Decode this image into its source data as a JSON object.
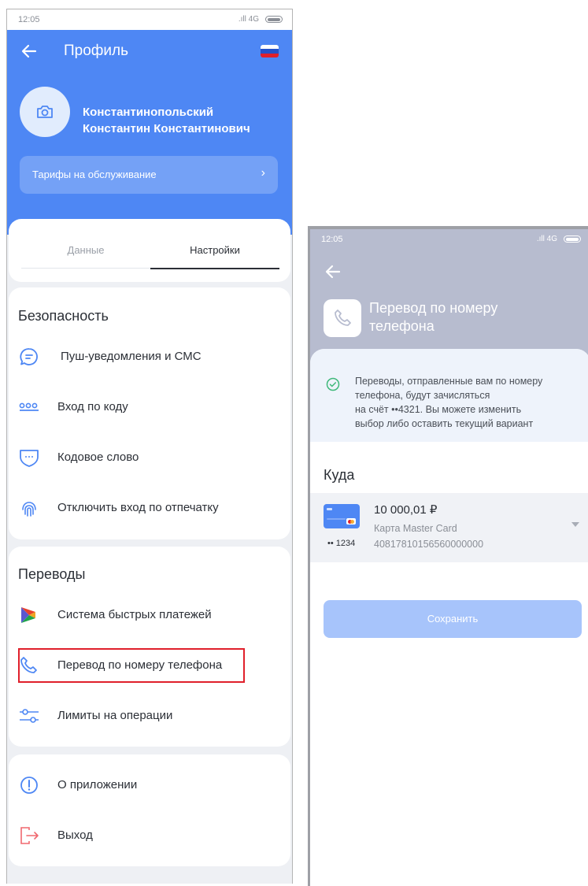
{
  "left_screen": {
    "status": {
      "time": "12:05",
      "network": ".ıll 4G"
    },
    "header": {
      "title": "Профиль"
    },
    "profile": {
      "name_line1": "Константинопольский",
      "name_line2": "Константин Константинович"
    },
    "tariff": {
      "label": "Тарифы на обслуживание",
      "chevron": "›"
    },
    "tabs": [
      {
        "label": "Данные",
        "active": false
      },
      {
        "label": "Настройки",
        "active": true
      }
    ],
    "security": {
      "title": "Безопасность",
      "items": [
        {
          "label": "Пуш-уведомления и СМС",
          "icon": "message-icon"
        },
        {
          "label": "Вход по коду",
          "icon": "code-dots-icon"
        },
        {
          "label": "Кодовое слово",
          "icon": "shield-icon"
        },
        {
          "label": "Отключить вход по отпечатку",
          "icon": "fingerprint-icon"
        }
      ]
    },
    "transfers": {
      "title": "Переводы",
      "items": [
        {
          "label": "Система быстрых платежей",
          "icon": "sbp-icon"
        },
        {
          "label": "Перевод по номеру телефона",
          "icon": "phone-icon",
          "highlighted": true
        },
        {
          "label": "Лимиты на операции",
          "icon": "sliders-icon"
        }
      ]
    },
    "misc": {
      "items": [
        {
          "label": "О приложении",
          "icon": "info-icon"
        },
        {
          "label": "Выход",
          "icon": "logout-icon"
        }
      ]
    },
    "colors": {
      "brand": "#4e87f4",
      "highlight": "#e0202b",
      "logout": "#f0686f"
    }
  },
  "right_screen": {
    "status": {
      "time": "12:05",
      "network": ".ıll 4G"
    },
    "header": {
      "title_line1": "Перевод по номеру",
      "title_line2": "телефона"
    },
    "info": {
      "line1": "Переводы, отправленные вам по номеру",
      "line2": "телефона, будут зачисляться",
      "line3": "на счёт  ••4321. Вы можете изменить",
      "line4": "выбор либо оставить текущий вариант"
    },
    "section_title": "Куда",
    "account": {
      "amount": "10 000,01 ₽",
      "type": "Карта Master Card",
      "number": "40817810156560000000",
      "mask": "•• 1234"
    },
    "save_button": "Сохранить",
    "colors": {
      "header_bg": "#b7bccf",
      "button_bg": "#a7c4fb",
      "success": "#3fb87a"
    }
  }
}
